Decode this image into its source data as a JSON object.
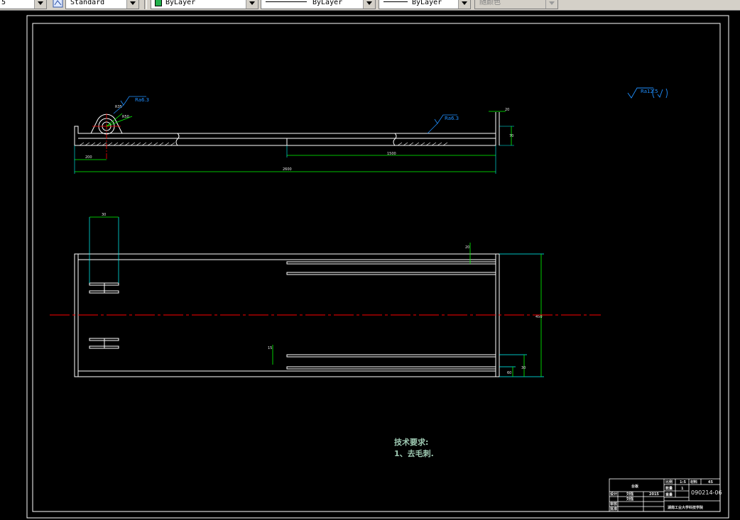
{
  "toolbar": {
    "layer_value": "5",
    "plot_style_value": "Standard",
    "color_value": "ByLayer",
    "linetype_value": "ByLayer",
    "lineweight_value": "ByLayer",
    "plotstyle_value": "随颜色",
    "accent_color": "#22b14c"
  },
  "drawing": {
    "tech_req_title": "技术要求:",
    "tech_req_item": "1、去毛刺.",
    "top_view": {
      "dim_left": "200",
      "dim_total": "2600",
      "dim_slot": "1500",
      "dim_end_small": "20",
      "dim_end_height": "70",
      "dim_radius_a": "R35",
      "dim_radius_b": "R50",
      "rough_left": "Ra6.3",
      "rough_right": "Ra6.3"
    },
    "plan_view": {
      "dim_lug_width": "30",
      "dim_slot_small": "20",
      "dim_total_height": "450",
      "dim_slot_left": "15",
      "dim_bottom_a": "60",
      "dim_bottom_b": "30"
    },
    "general_roughness": "Ra12.5",
    "title_block": {
      "name": "台板",
      "designer_label": "设计",
      "designer": "刘强",
      "date": "2015",
      "check_label": "审核",
      "checker": "刘强",
      "approve_label": "批准",
      "material_label": "比例",
      "material_value": "1:5",
      "qty_label": "数量",
      "qty_value": "1",
      "weight_label": "重量",
      "mat_label": "材料",
      "mat_value": "45",
      "drawing_no": "090214-06",
      "school": "湖南工业大学科技学院"
    },
    "colors": {
      "outline": "#ffffff",
      "dimension": "#00ff00",
      "extension": "#00ffff",
      "centerline": "#ff0000",
      "roughness": "#1f8fff",
      "text": "#9ec9b2"
    }
  }
}
